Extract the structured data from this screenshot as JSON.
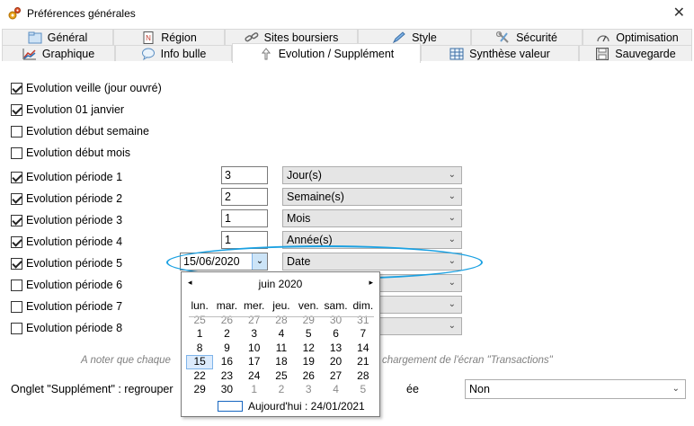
{
  "window": {
    "title": "Préférences générales",
    "close_glyph": "✕",
    "icon": "gears-icon"
  },
  "tabs": {
    "row1": [
      {
        "label": "Général",
        "icon": "folder-icon"
      },
      {
        "label": "Région",
        "icon": "region-icon"
      },
      {
        "label": "Sites boursiers",
        "icon": "link-icon"
      },
      {
        "label": "Style",
        "icon": "pencil-icon"
      },
      {
        "label": "Sécurité",
        "icon": "tools-icon"
      },
      {
        "label": "Optimisation",
        "icon": "gauge-icon"
      }
    ],
    "row2": [
      {
        "label": "Graphique",
        "icon": "chart-icon"
      },
      {
        "label": "Info bulle",
        "icon": "bubble-icon"
      },
      {
        "label": "Evolution / Supplément",
        "icon": "arrow-up-icon",
        "active": true
      },
      {
        "label": "Synthèse valeur",
        "icon": "grid-icon"
      },
      {
        "label": "Sauvegarde",
        "icon": "save-icon"
      }
    ]
  },
  "options": {
    "veille": {
      "label": "Evolution veille (jour ouvré)",
      "checked": true
    },
    "janvier": {
      "label": "Evolution 01 janvier",
      "checked": true
    },
    "semaine": {
      "label": "Evolution début semaine",
      "checked": false
    },
    "mois": {
      "label": "Evolution début mois",
      "checked": false
    }
  },
  "periods": [
    {
      "label": "Evolution période 1",
      "checked": true,
      "value": "3",
      "unit": "Jour(s)"
    },
    {
      "label": "Evolution période 2",
      "checked": true,
      "value": "2",
      "unit": "Semaine(s)"
    },
    {
      "label": "Evolution période 3",
      "checked": true,
      "value": "1",
      "unit": "Mois"
    },
    {
      "label": "Evolution période 4",
      "checked": true,
      "value": "1",
      "unit": "Année(s)"
    },
    {
      "label": "Evolution période 5",
      "checked": true,
      "value": "15/06/2020",
      "unit": "Date"
    },
    {
      "label": "Evolution période 6",
      "checked": false
    },
    {
      "label": "Evolution période 7",
      "checked": false
    },
    {
      "label": "Evolution période 8",
      "checked": false
    }
  ],
  "note_left": "A noter que chaque",
  "note_right": "chargement de l'écran \"Transactions\"",
  "supplement": {
    "label_left": "Onglet \"Supplément\" : regrouper",
    "label_right": "ée",
    "value": "Non"
  },
  "calendar": {
    "month": "juin 2020",
    "prev_glyph": "◂",
    "next_glyph": "▸",
    "weekdays": [
      "lun.",
      "mar.",
      "mer.",
      "jeu.",
      "ven.",
      "sam.",
      "dim."
    ],
    "weeks": [
      [
        "25",
        "26",
        "27",
        "28",
        "29",
        "30",
        "31"
      ],
      [
        "1",
        "2",
        "3",
        "4",
        "5",
        "6",
        "7"
      ],
      [
        "8",
        "9",
        "10",
        "11",
        "12",
        "13",
        "14"
      ],
      [
        "15",
        "16",
        "17",
        "18",
        "19",
        "20",
        "21"
      ],
      [
        "22",
        "23",
        "24",
        "25",
        "26",
        "27",
        "28"
      ],
      [
        "29",
        "30",
        "1",
        "2",
        "3",
        "4",
        "5"
      ]
    ],
    "selected": "15",
    "today_label": "Aujourd'hui : 24/01/2021"
  },
  "colors": {
    "accent": "#1ba1e2",
    "selection": "#dcebfc",
    "combo_bg": "#e5e5e5"
  }
}
